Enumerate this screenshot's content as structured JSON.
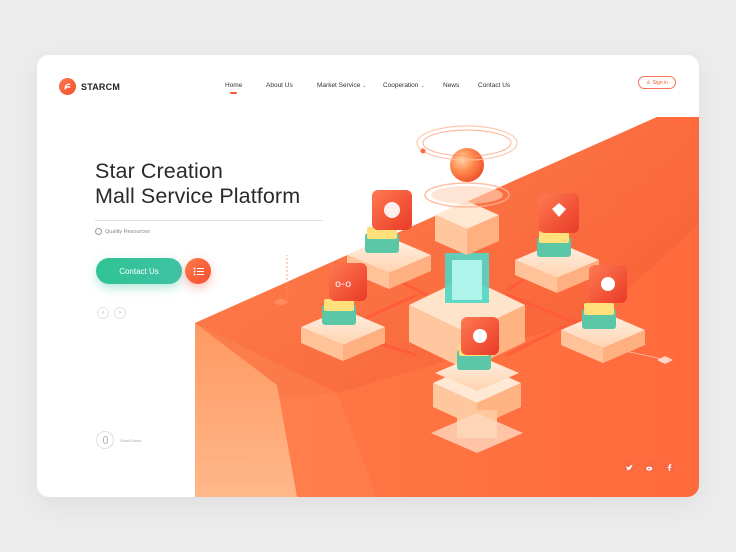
{
  "brand": {
    "name": "STARCM",
    "accent": "#f25a36",
    "cta_color": "#32c29a"
  },
  "nav": {
    "home": "Home",
    "about": "About Us",
    "market": "Market Service",
    "cooperation": "Cooperation",
    "news": "News",
    "contact": "Contact Us",
    "dropdown_icon": "chevron-down-icon"
  },
  "header": {
    "signin_label": "Sign in",
    "signin_icon": "user-icon"
  },
  "hero": {
    "title_line1": "Star Creation",
    "title_line2": "Mall Service Platform",
    "feature_label": "Quality Resources",
    "cta_label": "Contact Us",
    "menu_icon": "list-icon",
    "prev_icon": "chevron-left-icon",
    "next_icon": "chevron-right-icon"
  },
  "scroll": {
    "label": "Scroll Down",
    "icon": "mouse-icon"
  },
  "social": [
    "twitter-icon",
    "weibo-icon",
    "facebook-icon"
  ],
  "illustration": {
    "subject": "isometric-platform",
    "module_icons": [
      "fish-icon",
      "heart-icon",
      "cat-icon",
      "bird-icon",
      "penguin-icon"
    ]
  }
}
